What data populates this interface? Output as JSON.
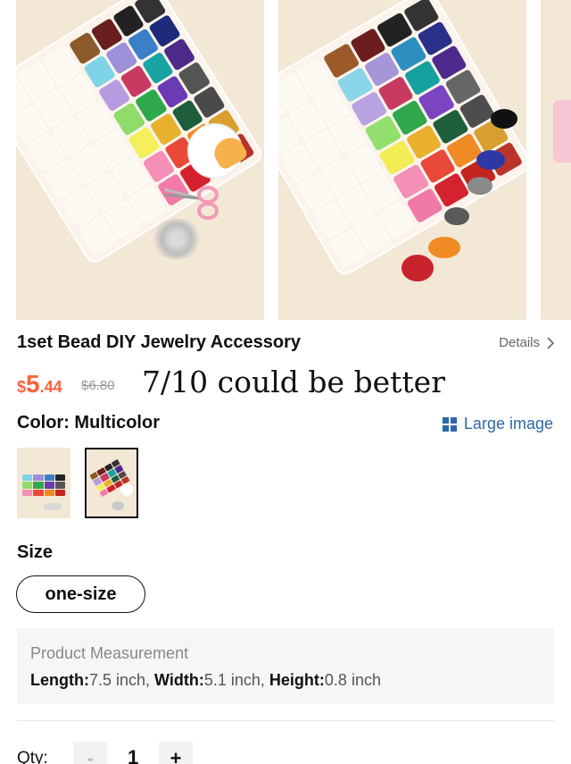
{
  "product": {
    "title": "1set Bead DIY Jewelry Accessory",
    "details_label": "Details",
    "price": {
      "currency": "$",
      "integer": "5",
      "decimal": ".44",
      "original": "$6.80",
      "color": "#fa6338"
    }
  },
  "overlay_text": "7/10 could be better",
  "color_section": {
    "label": "Color: Multicolor",
    "large_image_label": "Large image",
    "accent": "#2d68a8",
    "swatches": [
      {
        "selected": false
      },
      {
        "selected": true
      }
    ]
  },
  "size_section": {
    "label": "Size",
    "option": "one-size"
  },
  "measurement": {
    "title": "Product Measurement",
    "length_key": "Length:",
    "length_val": "7.5 inch",
    "sep1": ", ",
    "width_key": "Width:",
    "width_val": "5.1 inch",
    "sep2": ", ",
    "height_key": "Height:",
    "height_val": "0.8 inch"
  },
  "quantity": {
    "label": "Qty:",
    "minus": "-",
    "value": "1",
    "plus": "+"
  },
  "icons": {
    "details_chevron": "chevron-right-icon",
    "large_image": "grid-icon"
  }
}
